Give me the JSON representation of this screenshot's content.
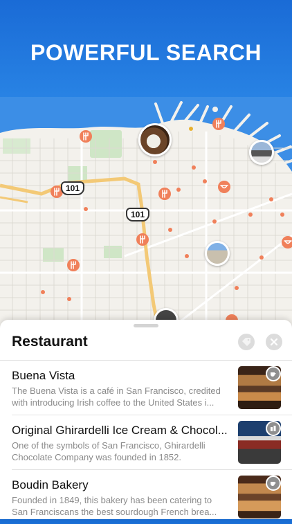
{
  "banner": {
    "headline": "POWERFUL SEARCH"
  },
  "map": {
    "route_labels": [
      "101",
      "101"
    ]
  },
  "sheet": {
    "title": "Restaurant",
    "results": [
      {
        "title": "Buena Vista",
        "desc_line1": "The Buena Vista is a café in San Francisco, credited",
        "desc_line2": "with introducing Irish coffee to the United States i...",
        "badge_icon": "coffee-cup-icon"
      },
      {
        "title": "Original Ghirardelli Ice Cream & Chocol...",
        "desc_line1": "One of the symbols of San Francisco, Ghirardelli",
        "desc_line2": "Chocolate Company was founded in 1852.",
        "badge_icon": "chess-pieces-icon"
      },
      {
        "title": "Boudin Bakery",
        "desc_line1": "Founded in 1849, this bakery has been catering to",
        "desc_line2": "San Franciscans the best sourdough French brea...",
        "badge_icon": "coffee-cup-icon"
      }
    ]
  },
  "colors": {
    "accent_blue": "#1a6fd6",
    "poi_orange": "#f0805a",
    "highway": "#f3c976"
  }
}
